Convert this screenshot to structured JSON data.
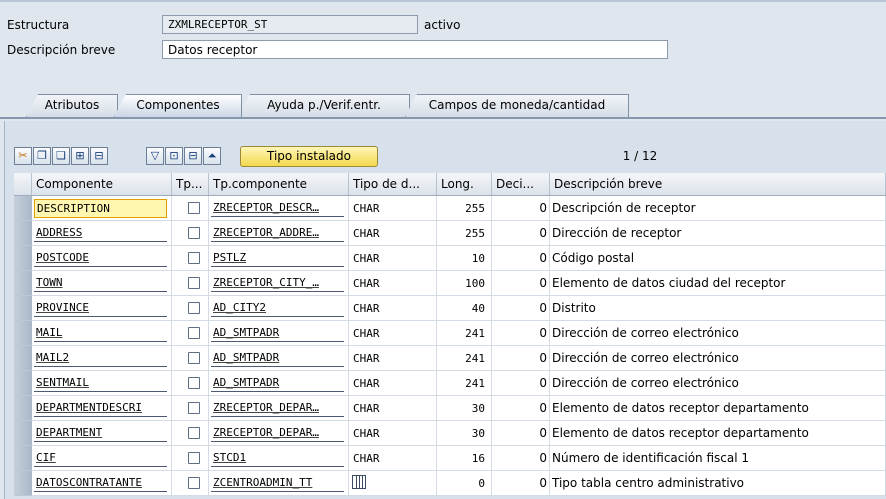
{
  "header": {
    "structure_label": "Estructura",
    "structure_value": "ZXMLRECEPTOR_ST",
    "status": "activo",
    "desc_label": "Descripción breve",
    "desc_value": "Datos receptor"
  },
  "tabs": [
    {
      "label": "Atributos",
      "active": false
    },
    {
      "label": "Componentes",
      "active": true
    },
    {
      "label": "Ayuda p./Verif.entr.",
      "active": false
    },
    {
      "label": "Campos de moneda/cantidad",
      "active": false
    }
  ],
  "toolbar": {
    "icons": [
      "scissors-icon",
      "copy-icon",
      "paste-icon",
      "insert-row-icon",
      "delete-row-icon",
      "filter-down-icon",
      "expand-icon",
      "collapse-icon",
      "page-up-icon"
    ],
    "tipo_button": "Tipo instalado",
    "pager": "1 / 12"
  },
  "table": {
    "columns": [
      "Componente",
      "Tp...",
      "Tp.componente",
      "Tipo de d...",
      "Long.",
      "Deci...",
      "Descripción breve"
    ],
    "rows": [
      {
        "comp": "DESCRIPTION",
        "tp": "ZRECEPTOR_DESCR…",
        "type": "CHAR",
        "len": "255",
        "dec": "0",
        "desc": "Descripción de receptor"
      },
      {
        "comp": "ADDRESS",
        "tp": "ZRECEPTOR_ADDRE…",
        "type": "CHAR",
        "len": "255",
        "dec": "0",
        "desc": "Dirección de receptor"
      },
      {
        "comp": "POSTCODE",
        "tp": "PSTLZ",
        "type": "CHAR",
        "len": "10",
        "dec": "0",
        "desc": "Código postal"
      },
      {
        "comp": "TOWN",
        "tp": "ZRECEPTOR_CITY_…",
        "type": "CHAR",
        "len": "100",
        "dec": "0",
        "desc": "Elemento de datos ciudad del receptor"
      },
      {
        "comp": "PROVINCE",
        "tp": "AD_CITY2",
        "type": "CHAR",
        "len": "40",
        "dec": "0",
        "desc": "Distrito"
      },
      {
        "comp": "MAIL",
        "tp": "AD_SMTPADR",
        "type": "CHAR",
        "len": "241",
        "dec": "0",
        "desc": "Dirección de correo electrónico"
      },
      {
        "comp": "MAIL2",
        "tp": "AD_SMTPADR",
        "type": "CHAR",
        "len": "241",
        "dec": "0",
        "desc": "Dirección de correo electrónico"
      },
      {
        "comp": "SENTMAIL",
        "tp": "AD_SMTPADR",
        "type": "CHAR",
        "len": "241",
        "dec": "0",
        "desc": "Dirección de correo electrónico"
      },
      {
        "comp": "DEPARTMENTDESCRI",
        "tp": "ZRECEPTOR_DEPAR…",
        "type": "CHAR",
        "len": "30",
        "dec": "0",
        "desc": "Elemento de datos receptor departamento"
      },
      {
        "comp": "DEPARTMENT",
        "tp": "ZRECEPTOR_DEPAR…",
        "type": "CHAR",
        "len": "30",
        "dec": "0",
        "desc": "Elemento de datos receptor departamento"
      },
      {
        "comp": "CIF",
        "tp": "STCD1",
        "type": "CHAR",
        "len": "16",
        "dec": "0",
        "desc": "Número de identificación fiscal 1"
      },
      {
        "comp": "DATOSCONTRATANTE",
        "tp": "ZCENTROADMIN_TT",
        "type": "",
        "len": "0",
        "dec": "0",
        "desc": "Tipo tabla centro administrativo"
      }
    ]
  }
}
